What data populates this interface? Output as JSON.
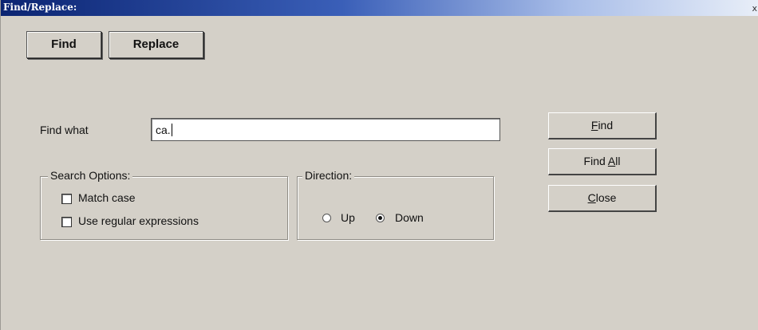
{
  "window": {
    "title": "Find/Replace:",
    "close_glyph": "x"
  },
  "mode_tabs": {
    "find_label": "Find",
    "replace_label": "Replace"
  },
  "find_what": {
    "label": "Find what",
    "value": "ca."
  },
  "search_options": {
    "legend": "Search Options:",
    "match_case": {
      "label": "Match case",
      "checked": false
    },
    "use_regex": {
      "label": "Use regular expressions",
      "checked": false
    }
  },
  "direction": {
    "legend": "Direction:",
    "up": {
      "label": "Up",
      "checked": false
    },
    "down": {
      "label": "Down",
      "checked": true
    }
  },
  "actions": {
    "find": {
      "prefix": "",
      "mnemonic": "F",
      "suffix": "ind"
    },
    "find_all": {
      "prefix": "Find ",
      "mnemonic": "A",
      "suffix": "ll"
    },
    "close": {
      "prefix": "",
      "mnemonic": "C",
      "suffix": "lose"
    }
  }
}
